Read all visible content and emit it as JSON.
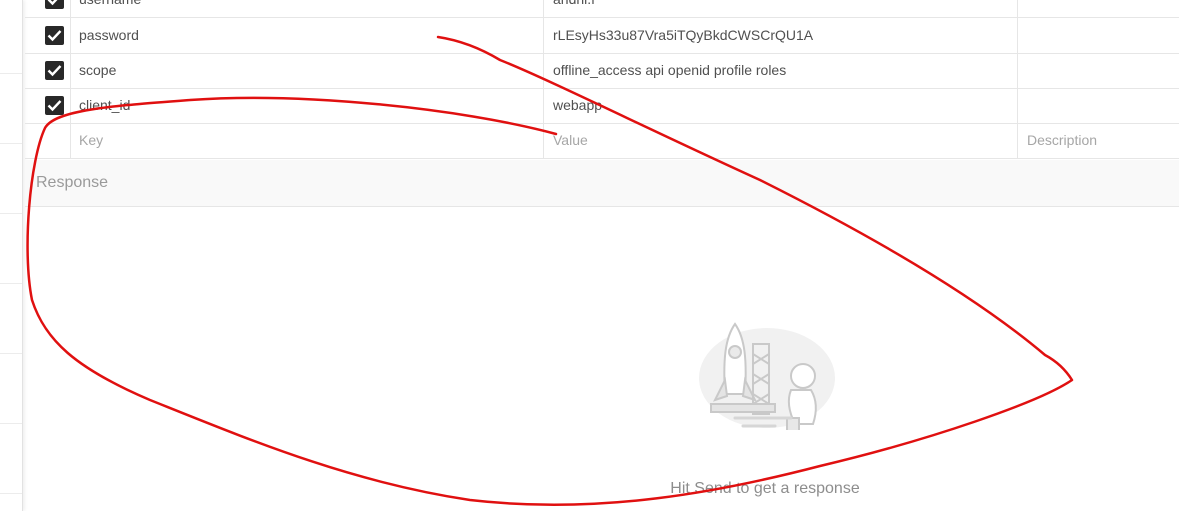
{
  "params": {
    "rows": [
      {
        "checked": true,
        "key": "username",
        "value": "andhi.f",
        "description": ""
      },
      {
        "checked": true,
        "key": "password",
        "value": "rLEsyHs33u87Vra5iTQyBkdCWSCrQU1A",
        "description": ""
      },
      {
        "checked": true,
        "key": "scope",
        "value": "offline_access api openid profile roles",
        "description": ""
      },
      {
        "checked": true,
        "key": "client_id",
        "value": "webapp",
        "description": ""
      }
    ],
    "placeholder": {
      "key": "Key",
      "value": "Value",
      "description": "Description"
    }
  },
  "response": {
    "title": "Response",
    "empty_hint": "Hit Send to get a response"
  },
  "colors": {
    "annotation": "#e01010",
    "checkbox": "#282828"
  },
  "icons": {
    "checkbox": "checkmark-icon",
    "illustration": "rocket-astronaut-illustration"
  }
}
